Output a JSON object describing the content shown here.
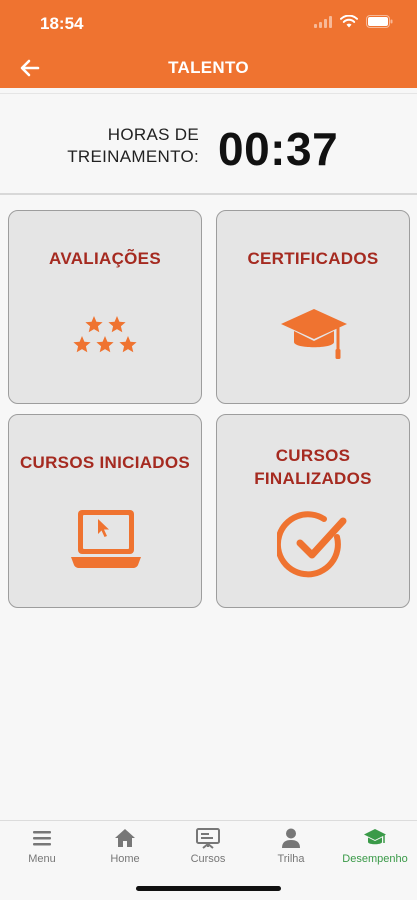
{
  "status": {
    "time": "18:54"
  },
  "header": {
    "title": "TALENTO"
  },
  "hours": {
    "label_line1": "HORAS DE",
    "label_line2": "TREINAMENTO:",
    "value": "00:37"
  },
  "cards": {
    "avaliacoes": {
      "label": "AVALIAÇÕES",
      "icon": "stars-icon"
    },
    "certificados": {
      "label": "CERTIFICADOS",
      "icon": "graduation-cap-icon"
    },
    "cursos_iniciados": {
      "label": "CURSOS INICIADOS",
      "icon": "laptop-icon"
    },
    "cursos_finalizados": {
      "label_line1": "CURSOS",
      "label_line2": "FINALIZADOS",
      "icon": "check-circle-icon"
    }
  },
  "nav": {
    "items": [
      {
        "label": "Menu",
        "icon": "menu-icon"
      },
      {
        "label": "Home",
        "icon": "home-icon"
      },
      {
        "label": "Cursos",
        "icon": "presentation-icon"
      },
      {
        "label": "Trilha",
        "icon": "user-icon"
      },
      {
        "label": "Desempenho",
        "icon": "graduation-cap-icon",
        "active": true
      }
    ]
  },
  "colors": {
    "accent": "#ef7330",
    "card_text": "#a52a20",
    "active_nav": "#3a9a48"
  }
}
